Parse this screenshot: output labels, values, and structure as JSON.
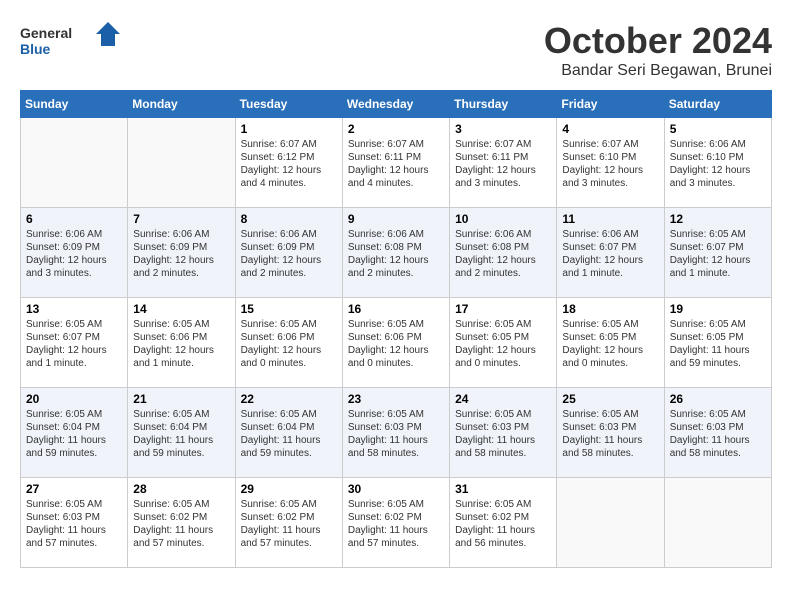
{
  "logo": {
    "general": "General",
    "blue": "Blue"
  },
  "title": "October 2024",
  "location": "Bandar Seri Begawan, Brunei",
  "days_header": [
    "Sunday",
    "Monday",
    "Tuesday",
    "Wednesday",
    "Thursday",
    "Friday",
    "Saturday"
  ],
  "weeks": [
    [
      {
        "day": "",
        "info": ""
      },
      {
        "day": "",
        "info": ""
      },
      {
        "day": "1",
        "info": "Sunrise: 6:07 AM\nSunset: 6:12 PM\nDaylight: 12 hours\nand 4 minutes."
      },
      {
        "day": "2",
        "info": "Sunrise: 6:07 AM\nSunset: 6:11 PM\nDaylight: 12 hours\nand 4 minutes."
      },
      {
        "day": "3",
        "info": "Sunrise: 6:07 AM\nSunset: 6:11 PM\nDaylight: 12 hours\nand 3 minutes."
      },
      {
        "day": "4",
        "info": "Sunrise: 6:07 AM\nSunset: 6:10 PM\nDaylight: 12 hours\nand 3 minutes."
      },
      {
        "day": "5",
        "info": "Sunrise: 6:06 AM\nSunset: 6:10 PM\nDaylight: 12 hours\nand 3 minutes."
      }
    ],
    [
      {
        "day": "6",
        "info": "Sunrise: 6:06 AM\nSunset: 6:09 PM\nDaylight: 12 hours\nand 3 minutes."
      },
      {
        "day": "7",
        "info": "Sunrise: 6:06 AM\nSunset: 6:09 PM\nDaylight: 12 hours\nand 2 minutes."
      },
      {
        "day": "8",
        "info": "Sunrise: 6:06 AM\nSunset: 6:09 PM\nDaylight: 12 hours\nand 2 minutes."
      },
      {
        "day": "9",
        "info": "Sunrise: 6:06 AM\nSunset: 6:08 PM\nDaylight: 12 hours\nand 2 minutes."
      },
      {
        "day": "10",
        "info": "Sunrise: 6:06 AM\nSunset: 6:08 PM\nDaylight: 12 hours\nand 2 minutes."
      },
      {
        "day": "11",
        "info": "Sunrise: 6:06 AM\nSunset: 6:07 PM\nDaylight: 12 hours\nand 1 minute."
      },
      {
        "day": "12",
        "info": "Sunrise: 6:05 AM\nSunset: 6:07 PM\nDaylight: 12 hours\nand 1 minute."
      }
    ],
    [
      {
        "day": "13",
        "info": "Sunrise: 6:05 AM\nSunset: 6:07 PM\nDaylight: 12 hours\nand 1 minute."
      },
      {
        "day": "14",
        "info": "Sunrise: 6:05 AM\nSunset: 6:06 PM\nDaylight: 12 hours\nand 1 minute."
      },
      {
        "day": "15",
        "info": "Sunrise: 6:05 AM\nSunset: 6:06 PM\nDaylight: 12 hours\nand 0 minutes."
      },
      {
        "day": "16",
        "info": "Sunrise: 6:05 AM\nSunset: 6:06 PM\nDaylight: 12 hours\nand 0 minutes."
      },
      {
        "day": "17",
        "info": "Sunrise: 6:05 AM\nSunset: 6:05 PM\nDaylight: 12 hours\nand 0 minutes."
      },
      {
        "day": "18",
        "info": "Sunrise: 6:05 AM\nSunset: 6:05 PM\nDaylight: 12 hours\nand 0 minutes."
      },
      {
        "day": "19",
        "info": "Sunrise: 6:05 AM\nSunset: 6:05 PM\nDaylight: 11 hours\nand 59 minutes."
      }
    ],
    [
      {
        "day": "20",
        "info": "Sunrise: 6:05 AM\nSunset: 6:04 PM\nDaylight: 11 hours\nand 59 minutes."
      },
      {
        "day": "21",
        "info": "Sunrise: 6:05 AM\nSunset: 6:04 PM\nDaylight: 11 hours\nand 59 minutes."
      },
      {
        "day": "22",
        "info": "Sunrise: 6:05 AM\nSunset: 6:04 PM\nDaylight: 11 hours\nand 59 minutes."
      },
      {
        "day": "23",
        "info": "Sunrise: 6:05 AM\nSunset: 6:03 PM\nDaylight: 11 hours\nand 58 minutes."
      },
      {
        "day": "24",
        "info": "Sunrise: 6:05 AM\nSunset: 6:03 PM\nDaylight: 11 hours\nand 58 minutes."
      },
      {
        "day": "25",
        "info": "Sunrise: 6:05 AM\nSunset: 6:03 PM\nDaylight: 11 hours\nand 58 minutes."
      },
      {
        "day": "26",
        "info": "Sunrise: 6:05 AM\nSunset: 6:03 PM\nDaylight: 11 hours\nand 58 minutes."
      }
    ],
    [
      {
        "day": "27",
        "info": "Sunrise: 6:05 AM\nSunset: 6:03 PM\nDaylight: 11 hours\nand 57 minutes."
      },
      {
        "day": "28",
        "info": "Sunrise: 6:05 AM\nSunset: 6:02 PM\nDaylight: 11 hours\nand 57 minutes."
      },
      {
        "day": "29",
        "info": "Sunrise: 6:05 AM\nSunset: 6:02 PM\nDaylight: 11 hours\nand 57 minutes."
      },
      {
        "day": "30",
        "info": "Sunrise: 6:05 AM\nSunset: 6:02 PM\nDaylight: 11 hours\nand 57 minutes."
      },
      {
        "day": "31",
        "info": "Sunrise: 6:05 AM\nSunset: 6:02 PM\nDaylight: 11 hours\nand 56 minutes."
      },
      {
        "day": "",
        "info": ""
      },
      {
        "day": "",
        "info": ""
      }
    ]
  ]
}
